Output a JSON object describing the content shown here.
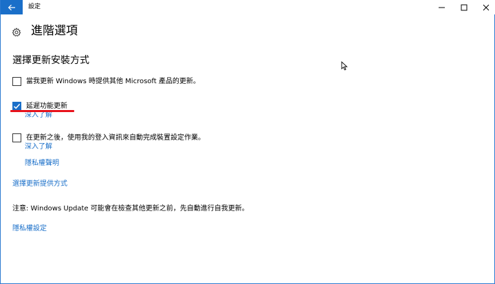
{
  "window": {
    "app_title": "設定",
    "accent_color": "#1a6fc9"
  },
  "header": {
    "title": "進階選項"
  },
  "section": {
    "title": "選擇更新安裝方式"
  },
  "options": [
    {
      "label": "當我更新 Windows 時提供其他 Microsoft 產品的更新。",
      "checked": false
    },
    {
      "label": "延遲功能更新",
      "checked": true,
      "link": "深入了解"
    },
    {
      "label": "在更新之後，使用我的登入資訊來自動完成裝置設定作業。",
      "checked": false,
      "link": "深入了解"
    }
  ],
  "links": {
    "privacy_statement": "隱私權聲明",
    "choose_delivery": "選擇更新提供方式",
    "privacy_settings": "隱私權設定"
  },
  "note": "注意: Windows Update 可能會在檢查其他更新之前，先自動進行自我更新。",
  "annotation": {
    "underline_color": "#e8121b"
  }
}
